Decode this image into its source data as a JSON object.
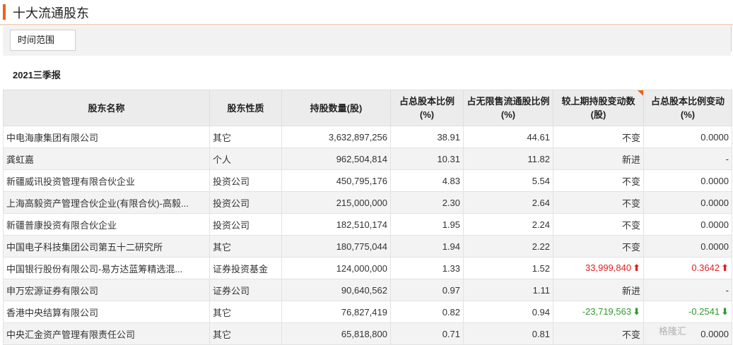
{
  "header": {
    "title": "十大流通股东"
  },
  "filter": {
    "time_range_label": "时间范围"
  },
  "period": "2021三季报",
  "table": {
    "columns": [
      "股东名称",
      "股东性质",
      "持股数量(股)",
      "占总股本比例(%)",
      "占无限售流通股比例(%)",
      "较上期持股变动数(股)",
      "占总股本比例变动(%)"
    ],
    "rows": [
      {
        "name": "中电海康集团有限公司",
        "nature": "其它",
        "shares": "3,632,897,256",
        "pct_total": "38.91",
        "pct_float": "44.61",
        "change": "不变",
        "pct_change": "0.0000",
        "dir": ""
      },
      {
        "name": "龚虹嘉",
        "nature": "个人",
        "shares": "962,504,814",
        "pct_total": "10.31",
        "pct_float": "11.82",
        "change": "新进",
        "pct_change": "-",
        "dir": ""
      },
      {
        "name": "新疆威讯投资管理有限合伙企业",
        "nature": "投资公司",
        "shares": "450,795,176",
        "pct_total": "4.83",
        "pct_float": "5.54",
        "change": "不变",
        "pct_change": "0.0000",
        "dir": ""
      },
      {
        "name": "上海高毅资产管理合伙企业(有限合伙)-高毅...",
        "nature": "投资公司",
        "shares": "215,000,000",
        "pct_total": "2.30",
        "pct_float": "2.64",
        "change": "不变",
        "pct_change": "0.0000",
        "dir": ""
      },
      {
        "name": "新疆普康投资有限合伙企业",
        "nature": "投资公司",
        "shares": "182,510,174",
        "pct_total": "1.95",
        "pct_float": "2.24",
        "change": "不变",
        "pct_change": "0.0000",
        "dir": ""
      },
      {
        "name": "中国电子科技集团公司第五十二研究所",
        "nature": "其它",
        "shares": "180,775,044",
        "pct_total": "1.94",
        "pct_float": "2.22",
        "change": "不变",
        "pct_change": "0.0000",
        "dir": ""
      },
      {
        "name": "中国银行股份有限公司-易方达蓝筹精选混...",
        "nature": "证券投资基金",
        "shares": "124,000,000",
        "pct_total": "1.33",
        "pct_float": "1.52",
        "change": "33,999,840",
        "pct_change": "0.3642",
        "dir": "up"
      },
      {
        "name": "申万宏源证券有限公司",
        "nature": "证券公司",
        "shares": "90,640,562",
        "pct_total": "0.97",
        "pct_float": "1.11",
        "change": "新进",
        "pct_change": "-",
        "dir": ""
      },
      {
        "name": "香港中央结算有限公司",
        "nature": "其它",
        "shares": "76,827,419",
        "pct_total": "0.82",
        "pct_float": "0.94",
        "change": "-23,719,563",
        "pct_change": "-0.2541",
        "dir": "down"
      },
      {
        "name": "中央汇金资产管理有限责任公司",
        "nature": "其它",
        "shares": "65,818,800",
        "pct_total": "0.71",
        "pct_float": "0.81",
        "change": "不变",
        "pct_change": "0.0000",
        "dir": ""
      }
    ]
  },
  "watermark": "格隆汇",
  "colors": {
    "accent": "#e8641b",
    "up": "#e02020",
    "down": "#2e9a2e"
  },
  "icons": {
    "up": "arrow-up-icon",
    "down": "arrow-down-icon"
  }
}
